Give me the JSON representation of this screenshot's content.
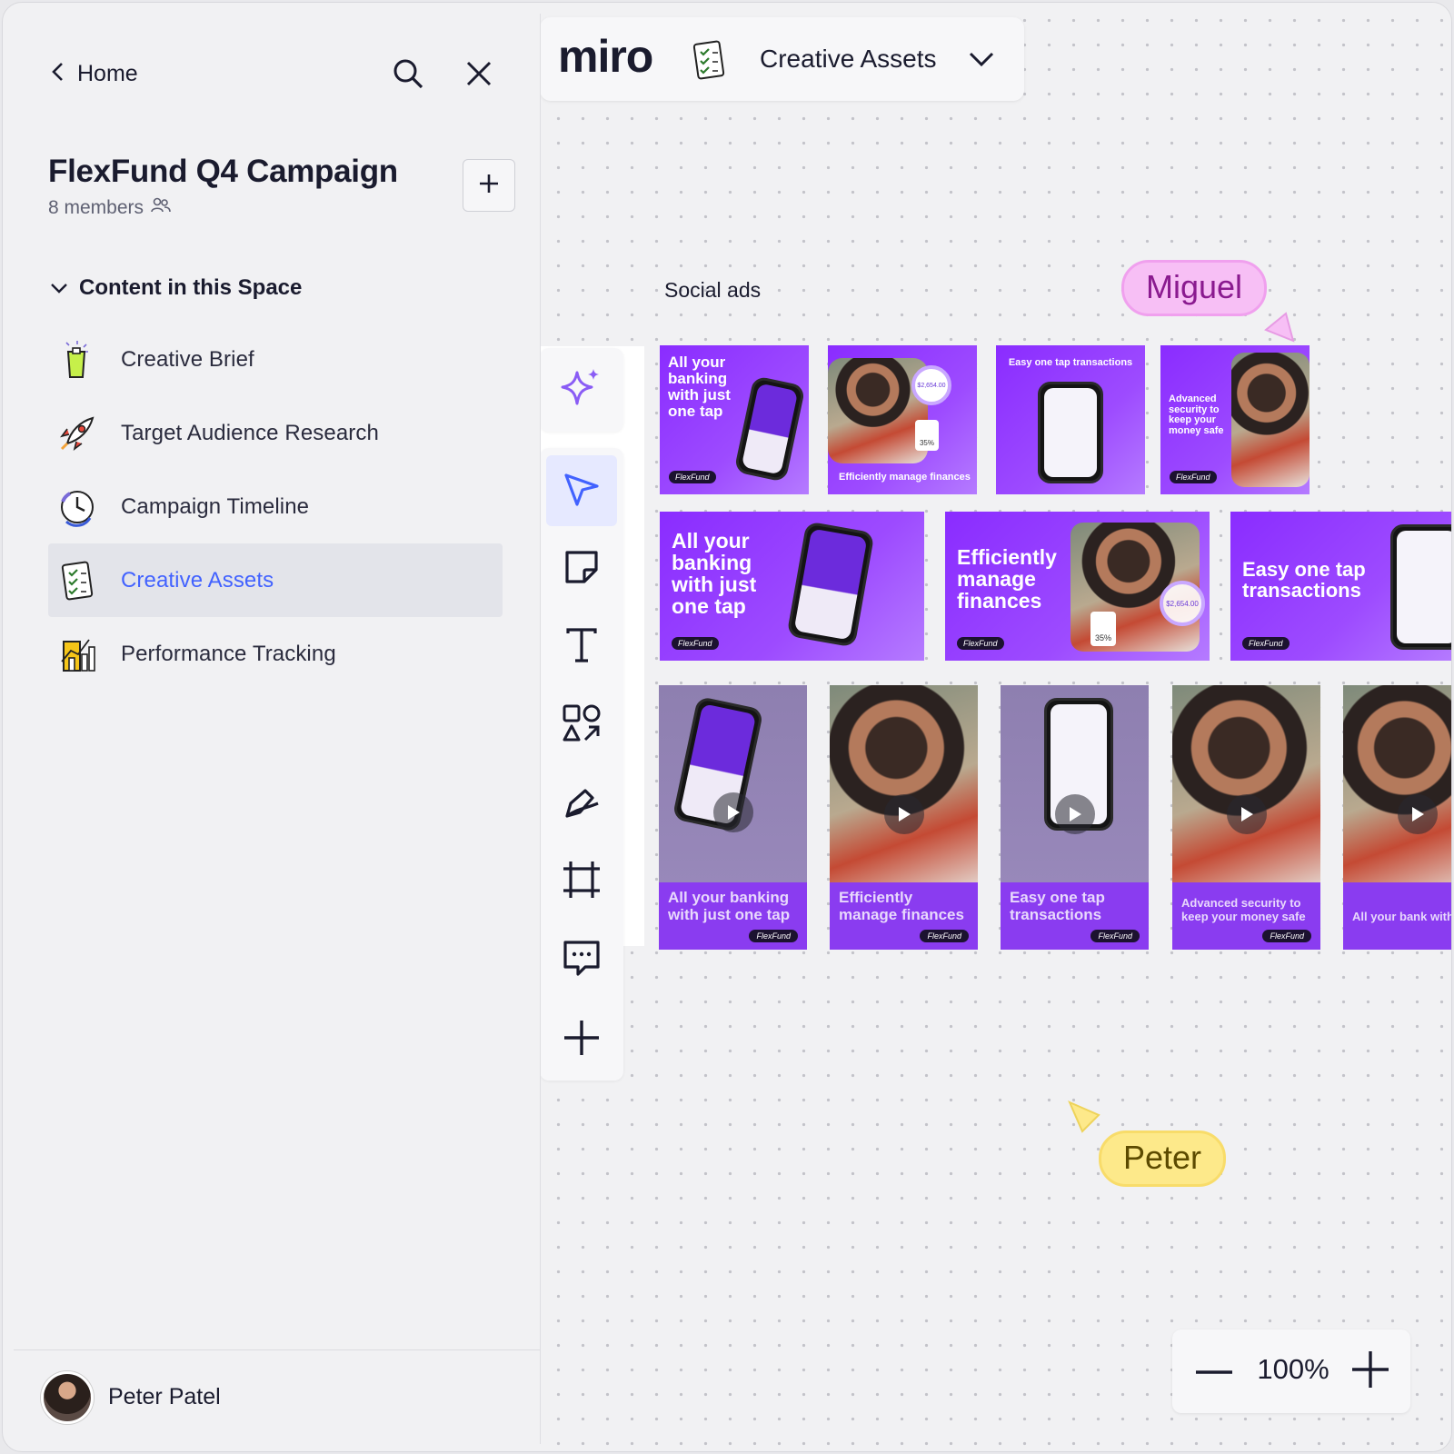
{
  "sidebar": {
    "back_label": "Home",
    "space_title": "FlexFund Q4 Campaign",
    "members": "8 members",
    "section_title": "Content in this Space",
    "items": [
      {
        "label": "Creative Brief",
        "icon": "clipboard-icon"
      },
      {
        "label": "Target Audience Research",
        "icon": "rocket-icon"
      },
      {
        "label": "Campaign Timeline",
        "icon": "clock-icon"
      },
      {
        "label": "Creative Assets",
        "icon": "checklist-icon",
        "active": true
      },
      {
        "label": "Performance Tracking",
        "icon": "chart-icon"
      }
    ],
    "user_name": "Peter Patel"
  },
  "board": {
    "logo": "miro",
    "name": "Creative Assets"
  },
  "canvas": {
    "frame_label": "Social ads",
    "row1": [
      {
        "headline": "All your banking with just one tap",
        "brand": "FlexFund"
      },
      {
        "caption": "Efficiently manage finances",
        "amount": "$2,654.00",
        "stat": "35%"
      },
      {
        "headline": "Easy one tap transactions"
      },
      {
        "headline": "Advanced security to keep your money safe",
        "brand": "FlexFund"
      }
    ],
    "row2": [
      {
        "headline": "All your banking with just one tap",
        "brand": "FlexFund"
      },
      {
        "headline": "Efficiently manage finances",
        "brand": "FlexFund",
        "amount": "$2,654.00",
        "stat": "35%"
      },
      {
        "headline": "Easy one tap transactions",
        "brand": "FlexFund"
      }
    ],
    "row3": [
      {
        "title": "All your banking with just one tap",
        "brand": "FlexFund"
      },
      {
        "title": "Efficiently manage finances",
        "brand": "FlexFund"
      },
      {
        "title": "Easy one tap transactions",
        "brand": "FlexFund"
      },
      {
        "title": "Advanced security to keep your money safe",
        "brand": "FlexFund"
      },
      {
        "title": "All your bank with just one",
        "brand": ""
      }
    ],
    "cursors": [
      {
        "name": "Miguel",
        "color": "#f7bff5"
      },
      {
        "name": "Peter",
        "color": "#fde98a"
      }
    ]
  },
  "toolbar": {
    "tools": [
      "ai-sparkle-icon",
      "select-icon",
      "sticky-note-icon",
      "text-icon",
      "shapes-icon",
      "pen-icon",
      "frame-icon",
      "comment-icon",
      "plus-icon"
    ],
    "active": "select-icon"
  },
  "zoom": {
    "value": "100%"
  },
  "colors": {
    "accent": "#4262ff",
    "ad_purple": "#8a2cff"
  }
}
